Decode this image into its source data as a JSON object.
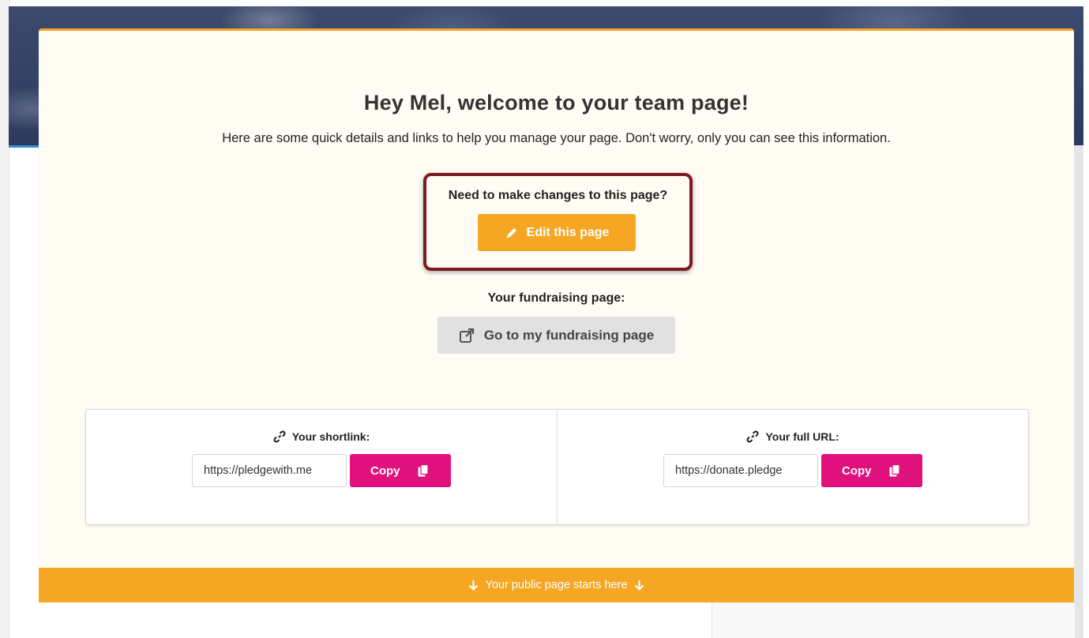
{
  "welcome": {
    "title": "Hey Mel, welcome to your team page!",
    "subtitle": "Here are some quick details and links to help you manage your page. Don't worry, only you can see this information."
  },
  "edit": {
    "label": "Need to make changes to this page?",
    "button_label": "Edit this page",
    "icon": "pencil-icon"
  },
  "fundraising": {
    "label": "Your fundraising page:",
    "button_label": "Go to my fundraising page",
    "icon": "external-link-icon"
  },
  "links": {
    "shortlink": {
      "label": "Your shortlink:",
      "value": "https://pledgewith.me",
      "copy_label": "Copy",
      "icon": "link-icon"
    },
    "full_url": {
      "label": "Your full URL:",
      "value": "https://donate.pledge",
      "copy_label": "Copy",
      "icon": "link-icon"
    }
  },
  "public_banner": {
    "text": "Your public page starts here"
  },
  "colors": {
    "accent_orange": "#f5a623",
    "copy_pink": "#e0107c",
    "highlight_border": "#7d1a1f",
    "panel_bg": "#fffdf3"
  }
}
